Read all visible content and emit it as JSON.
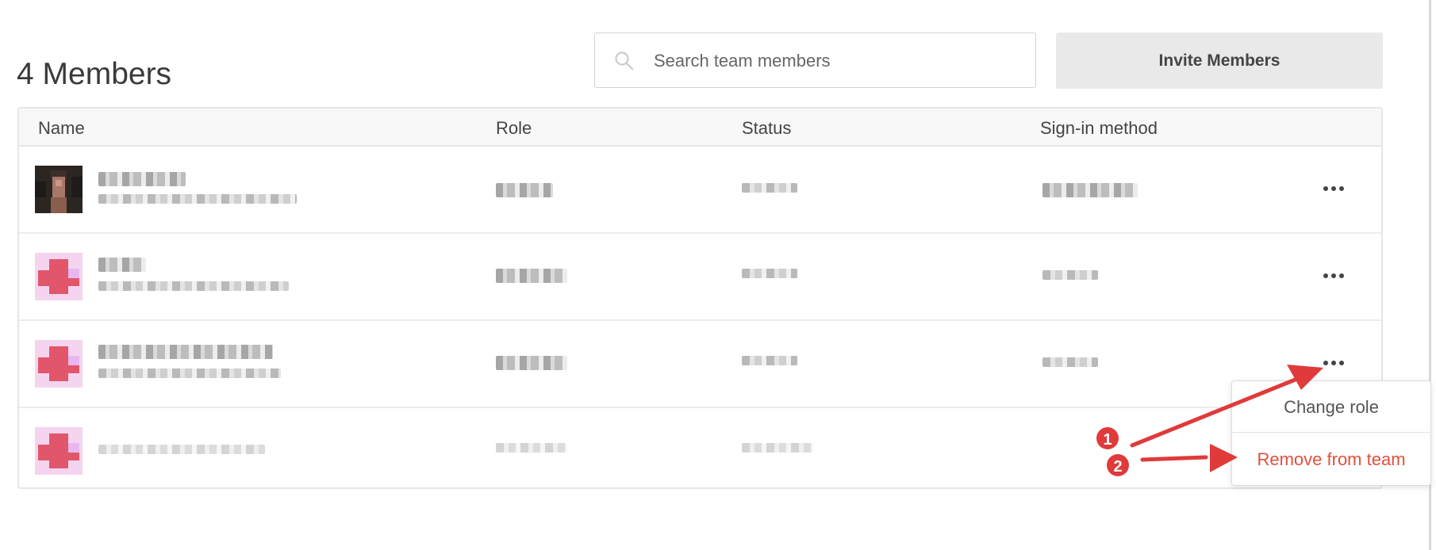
{
  "header": {
    "title": "4 Members",
    "search_placeholder": "Search team members",
    "invite_label": "Invite Members"
  },
  "table": {
    "columns": [
      "Name",
      "Role",
      "Status",
      "Sign-in method"
    ]
  },
  "context_menu": {
    "items": [
      "Change role",
      "Remove from team"
    ]
  },
  "annotations": {
    "step1": "1",
    "step2": "2"
  },
  "colors": {
    "accent_red": "#e0503b",
    "annotation_red": "#e03a3a"
  },
  "icons": {
    "search": "search-icon",
    "more": "more-horizontal-icon"
  }
}
